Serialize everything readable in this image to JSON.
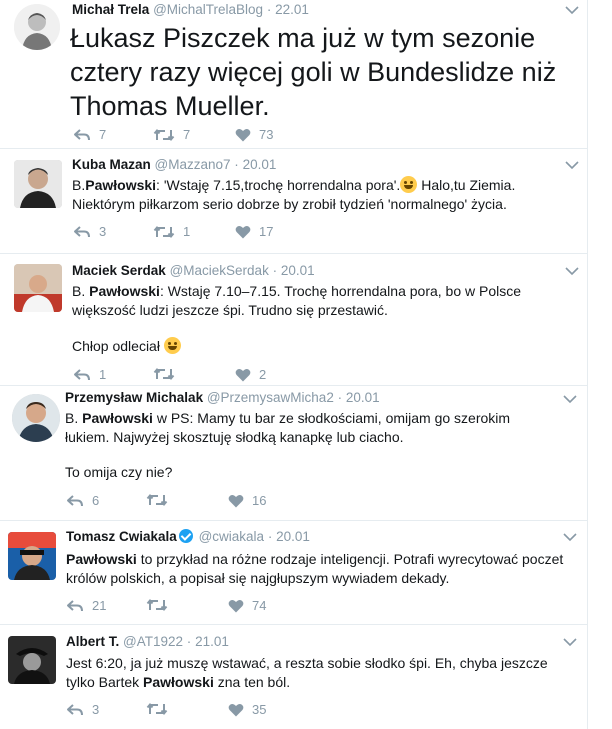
{
  "tweets": [
    {
      "name": "Michał Trela",
      "handle": "@MichalTrelaBlog",
      "date": "22.01",
      "text": "Łukasz Piszczek ma już w tym sezonie cztery razy więcej goli w Bundeslidze niż Thomas Mueller.",
      "replies": "7",
      "retweets": "7",
      "likes": "73"
    },
    {
      "name": "Kuba Mazan",
      "handle": "@Mazzano7",
      "date": "20.01",
      "text_a": "B.",
      "text_bold": "Pawłowski",
      "text_b": ": 'Wstaję 7.15,trochę horrendalna pora'.",
      "text_c": " Halo,tu Ziemia. Niektórym piłkarzom serio dobrze by zrobił tydzień 'normalnego' życia.",
      "replies": "3",
      "retweets": "1",
      "likes": "17"
    },
    {
      "name": "Maciek Serdak",
      "handle": "@MaciekSerdak",
      "date": "20.01",
      "text_a": "B. ",
      "text_bold": "Pawłowski",
      "text_b": ": Wstaję 7.10–7.15. Trochę horrendalna pora, bo w Polsce większość ludzi jeszcze śpi. Trudno się przestawić.",
      "text_c": "Chłop odleciał ",
      "replies": "1",
      "retweets": "",
      "likes": "2"
    },
    {
      "name": "Przemysław Michalak",
      "handle": "@PrzemysawMicha2",
      "date": "20.01",
      "text_a": "B. ",
      "text_bold": "Pawłowski",
      "text_b": " w PS: Mamy tu bar ze słodkościami, omijam go szerokim łukiem. Najwyżej skosztuję słodką kanapkę lub ciacho.",
      "text_c": "To omija czy nie?",
      "replies": "6",
      "retweets": "",
      "likes": "16"
    },
    {
      "name": "Tomasz Cwiakala",
      "handle": "@cwiakala",
      "date": "20.01",
      "text_bold": "Pawłowski",
      "text_b": " to przykład na różne rodzaje inteligencji. Potrafi wyrecytować poczet królów polskich, a popisał się najgłupszym wywiadem dekady.",
      "replies": "21",
      "retweets": "",
      "likes": "74"
    },
    {
      "name": "Albert T.",
      "handle": "@AT1922",
      "date": "21.01",
      "text_a": "Jest 6:20, ja już muszę wstawać, a reszta sobie słodko śpi. Eh, chyba jeszcze tylko Bartek ",
      "text_bold": "Pawłowski",
      "text_b": " zna ten ból.",
      "replies": "3",
      "retweets": "",
      "likes": "35"
    }
  ],
  "separator": "·",
  "colors": {
    "muted": "#8899a6",
    "text": "#14171a",
    "border": "#e6ecf0",
    "verified": "#1da1f2"
  },
  "icons": [
    "reply-icon",
    "retweet-icon",
    "like-icon",
    "chevron-down-icon",
    "verified-badge-icon",
    "emoji-icon"
  ]
}
